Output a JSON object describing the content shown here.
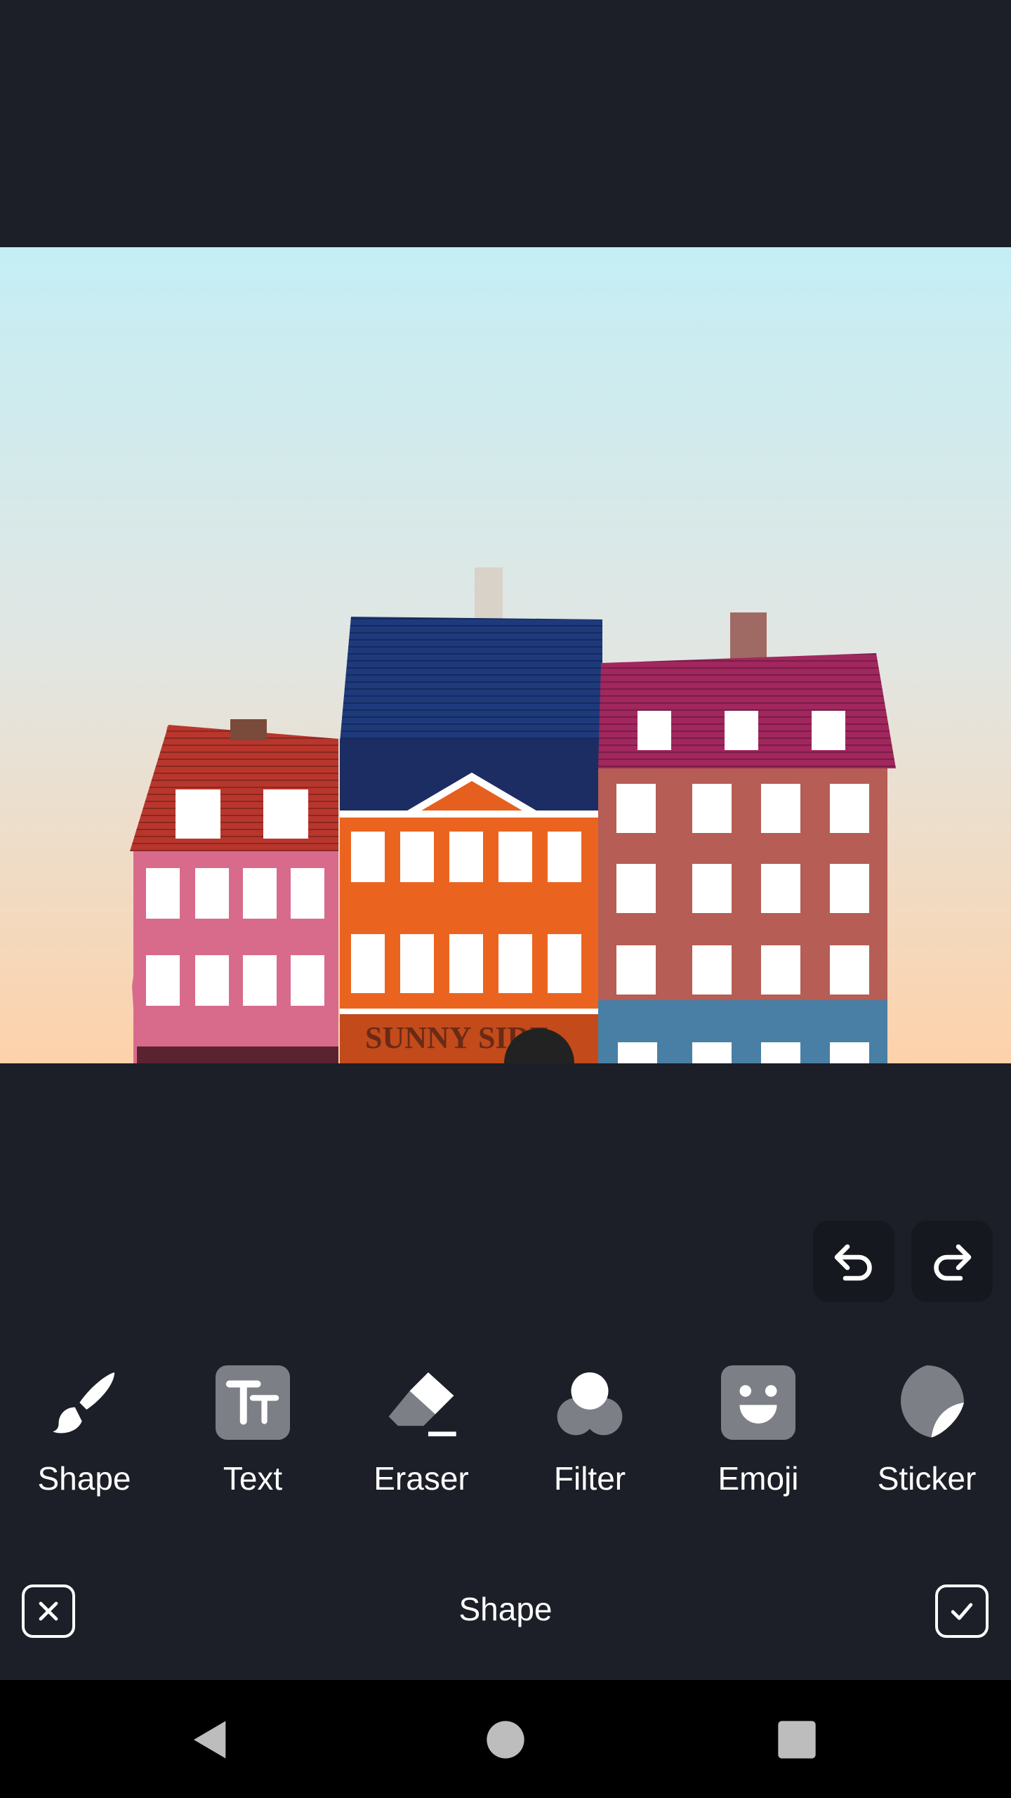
{
  "tools": [
    {
      "id": "shape",
      "label": "Shape",
      "icon": "paintbrush-icon"
    },
    {
      "id": "text",
      "label": "Text",
      "icon": "text-tt-icon"
    },
    {
      "id": "eraser",
      "label": "Eraser",
      "icon": "eraser-icon"
    },
    {
      "id": "filter",
      "label": "Filter",
      "icon": "filter-circles-icon"
    },
    {
      "id": "emoji",
      "label": "Emoji",
      "icon": "emoji-face-icon"
    },
    {
      "id": "sticker",
      "label": "Sticker",
      "icon": "sticker-peel-icon"
    }
  ],
  "history": {
    "undo_icon": "undo-icon",
    "redo_icon": "redo-icon"
  },
  "actionbar": {
    "title": "Shape",
    "cancel_icon": "close-icon",
    "confirm_icon": "check-icon"
  },
  "photo": {
    "storefront_sign": "SUNNY SIDE"
  },
  "colors": {
    "background": "#1c1f27",
    "tool_icon_gray": "#7c7f86",
    "button_dark": "#15181e"
  }
}
